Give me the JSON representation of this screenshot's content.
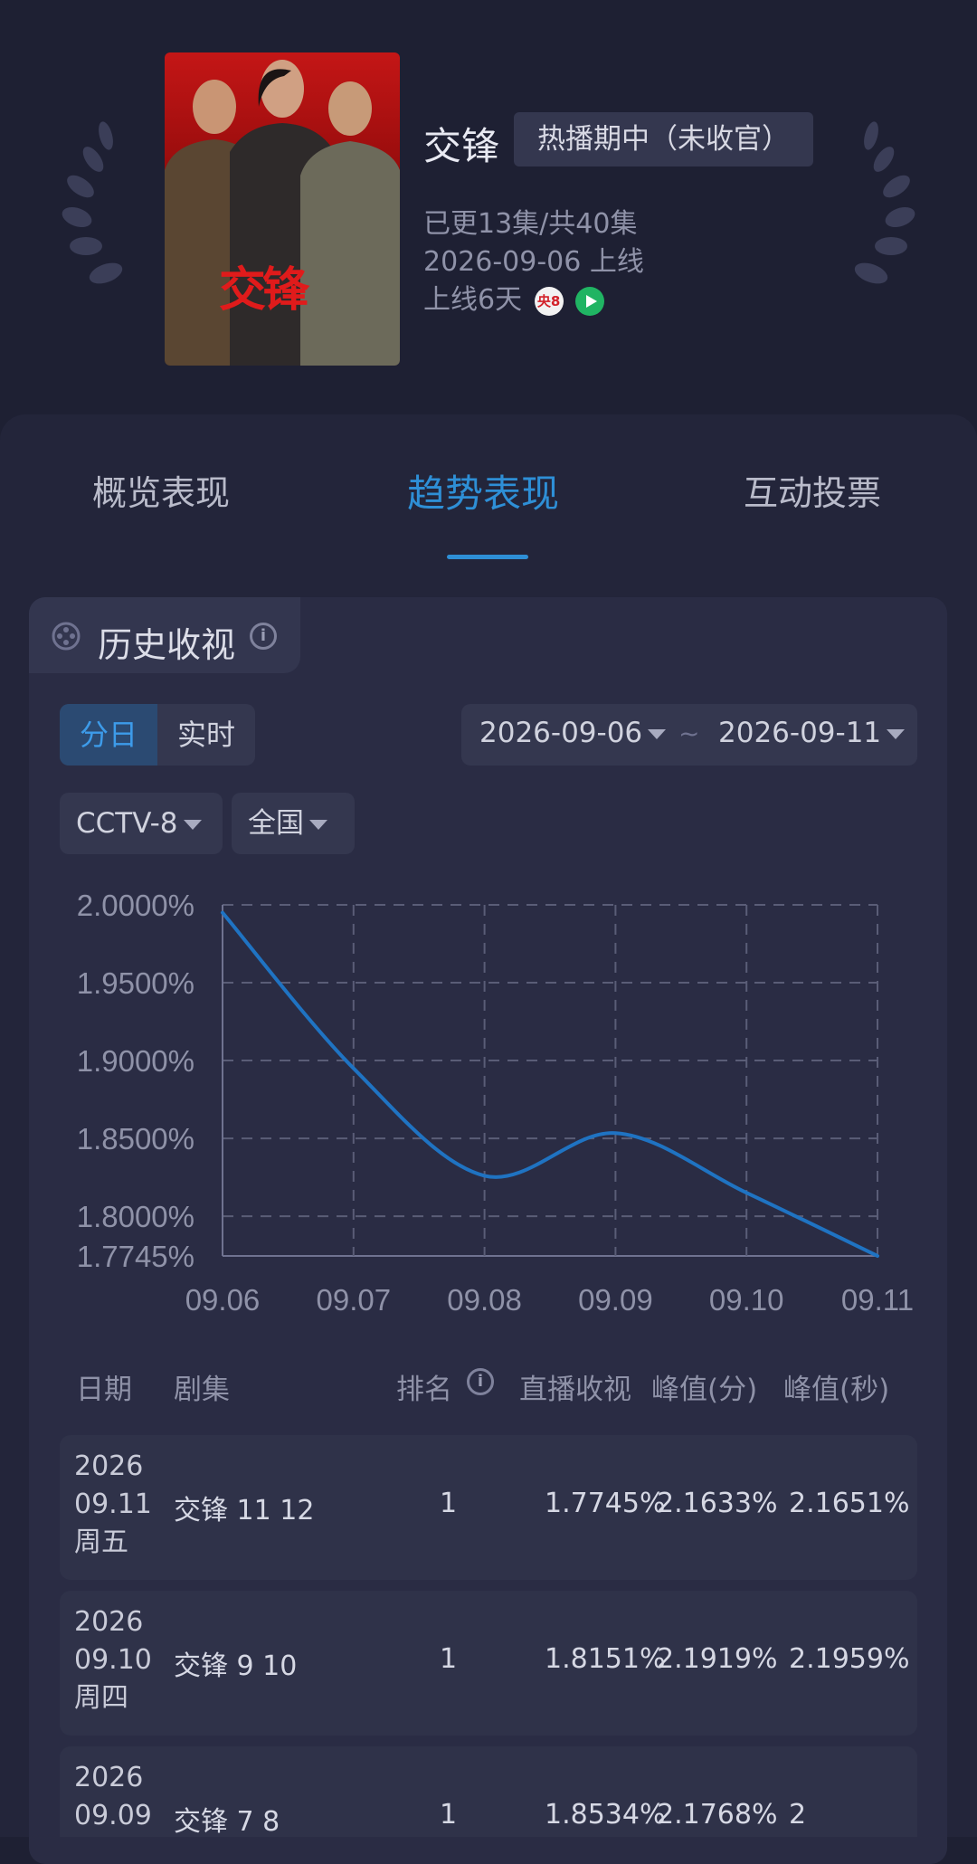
{
  "show": {
    "title": "交锋",
    "status": "热播期中（未收官）",
    "episodes": "已更13集/共40集",
    "release": "2026-09-06 上线",
    "days_online": "上线6天",
    "channel_icon_text": "央8",
    "poster_title": "交锋",
    "icons": [
      "laurel-icon",
      "cctv8-icon",
      "play-icon"
    ]
  },
  "tabs": [
    "概览表现",
    "趋势表现",
    "互动投票"
  ],
  "section": {
    "title": "历史收视"
  },
  "controls": {
    "mode_daily": "分日",
    "mode_realtime": "实时",
    "date_from": "2026-09-06",
    "date_sep": "~",
    "date_to": "2026-09-11",
    "channel": "CCTV-8",
    "region": "全国"
  },
  "chart_data": {
    "type": "line",
    "categories": [
      "09.06",
      "09.07",
      "09.08",
      "09.09",
      "09.10",
      "09.11"
    ],
    "series": [
      {
        "values": [
          1.995,
          1.895,
          1.826,
          1.8534,
          1.8151,
          1.7745
        ]
      }
    ],
    "ytick_labels": [
      "2.0000%",
      "1.9500%",
      "1.9000%",
      "1.8500%",
      "1.8000%",
      "1.7745%"
    ],
    "yticks": [
      2.0,
      1.95,
      1.9,
      1.85,
      1.8,
      1.7745
    ],
    "ylim": [
      1.7745,
      2.0
    ],
    "grid": true,
    "color": "#1f73c2"
  },
  "table": {
    "headers": [
      "日期",
      "剧集",
      "排名",
      "直播收视",
      "峰值(分)",
      "峰值(秒)"
    ],
    "rows": [
      {
        "year": "2026",
        "date": "09.11",
        "weekday": "周五",
        "episode": "交锋 11 12",
        "rank": "1",
        "live": "1.7745%",
        "peak_min": "2.1633%",
        "peak_sec": "2.1651%"
      },
      {
        "year": "2026",
        "date": "09.10",
        "weekday": "周四",
        "episode": "交锋 9 10",
        "rank": "1",
        "live": "1.8151%",
        "peak_min": "2.1919%",
        "peak_sec": "2.1959%"
      },
      {
        "year": "2026",
        "date": "09.09",
        "weekday": "",
        "episode": "交锋 7 8",
        "rank": "1",
        "live": "1.8534%",
        "peak_min": "2.1768%",
        "peak_sec": "2"
      }
    ]
  }
}
